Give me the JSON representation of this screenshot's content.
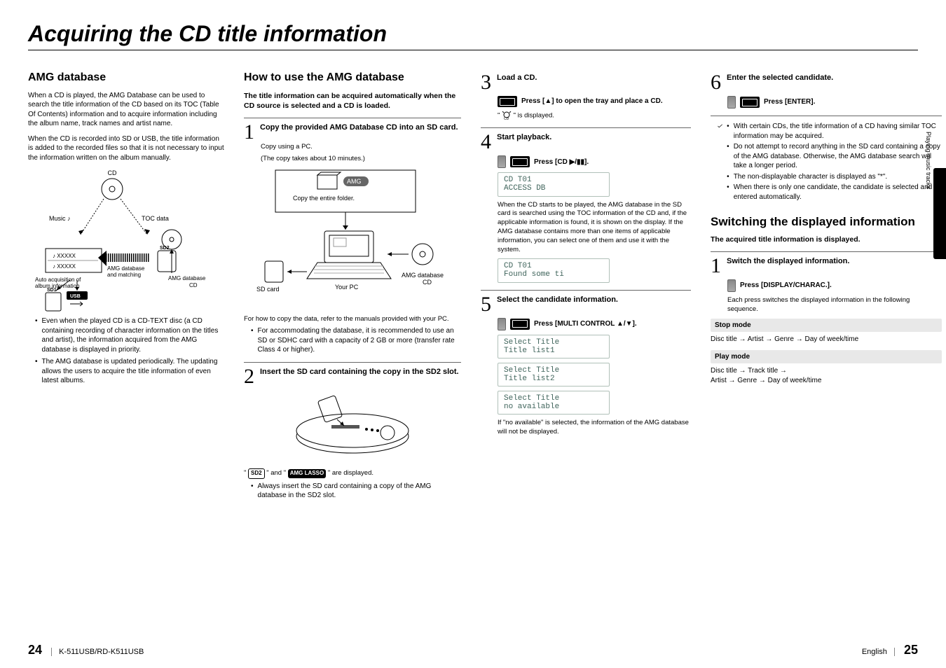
{
  "pageTitle": "Acquiring the CD title information",
  "col1": {
    "h2": "AMG database",
    "p1": "When a CD is played, the AMG Database can be used to search the title information of the CD based on its TOC (Table Of Contents) information and to acquire information including the album name, track names and artist name.",
    "p2": "When the CD is recorded into SD or USB, the title information is added to the recorded files so that it is not necessary to input the information written on the album manually.",
    "diagLabels": {
      "cd": "CD",
      "music": "Music",
      "toc": "TOC data",
      "xxxx": "XXXXX",
      "sd2": "SD2",
      "amgMatch": "AMG database\nand matching",
      "autoAcq": "Auto acquisition of\nalbum information",
      "amgCd": "AMG database\nCD",
      "sd1": "SD1",
      "usb": "USB"
    },
    "b1": "Even when the played CD is a CD-TEXT disc (a CD containing recording of character information on the titles and artist), the information acquired from the AMG database is displayed in priority.",
    "b2": "The AMG database is updated periodically. The updating allows the users to acquire the title information of even latest albums."
  },
  "col2": {
    "h2": "How to use the AMG database",
    "lead": "The title information can be acquired automatically when the CD source is selected and a CD is loaded.",
    "s1": "Copy the provided AMG Database CD into an SD card.",
    "s1a": "Copy using a PC.",
    "s1b": "(The copy takes about 10 minutes.)",
    "diag2": {
      "amg": "AMG",
      "copy": "Copy the entire folder.",
      "sd": "SD card",
      "pc": "Your PC",
      "amgcd": "AMG database\nCD"
    },
    "after1": "For how to copy the data, refer to the manuals provided with your PC.",
    "b1": "For accommodating the database, it is recommended to use an SD or SDHC card with a capacity of 2 GB or more (transfer rate Class 4 or higher).",
    "s2": "Insert the SD card containing the copy in the SD2 slot.",
    "disp": "\" SD2 \" and \" AMG LASSO \" are displayed.",
    "b2": "Always insert the SD card containing a copy of the AMG database in the SD2 slot."
  },
  "col3": {
    "s3": "Load a CD.",
    "s3a": "Press [▲] to open the tray and place a CD.",
    "s3b": "\"  \" is displayed.",
    "s3bIconHint": "cd-access",
    "s4": "Start playback.",
    "s4a": "Press [CD ▶/▮▮].",
    "lcd1a": "CD T01",
    "lcd1b": "ACCESS DB",
    "s4p": "When the CD starts to be played, the AMG database in the SD card is searched using the TOC information of the CD and, if the applicable information is found, it is shown on the display. If the AMG database contains more than one items of applicable information, you can select one of them and use it with the system.",
    "lcd2a": "CD T01",
    "lcd2b": "Found some ti",
    "s5": "Select the candidate information.",
    "s5a": "Press [MULTI CONTROL ▲/▼].",
    "lcd3a": "Select Title",
    "lcd3b": "Title list1",
    "lcd4a": "Select Title",
    "lcd4b": "Title list2",
    "lcd5a": "Select Title",
    "lcd5b": "no available",
    "s5p": "If \"no available\" is selected, the information of the AMG database will not be displayed."
  },
  "col4": {
    "s6": "Enter the selected candidate.",
    "s6a": "Press [ENTER].",
    "chk1": "With certain CDs, the title information of a CD having similar TOC information may be acquired.",
    "chk2": "Do not attempt to record anything in the SD card containing a copy of the AMG database. Otherwise, the AMG database search will take a longer period.",
    "chk3": "The non-displayable character is displayed as \"*\".",
    "chk4": "When there is only one candidate, the candidate is selected and entered automatically.",
    "h2": "Switching the displayed information",
    "lead": "The acquired title information is displayed.",
    "s1": "Switch the displayed information.",
    "s1a": "Press [DISPLAY/CHARAC.].",
    "p1": "Each press switches the displayed information in the following sequence.",
    "mode1": "Stop mode",
    "mode1t": "Disc title → Artist → Genre → Day of week/time",
    "mode2": "Play mode",
    "mode2t": "Disc title → Track title →\nArtist → Genre → Day of week/time"
  },
  "footer": {
    "leftNum": "24",
    "leftText": "K-511USB/RD-K511USB",
    "rightText": "English",
    "rightNum": "25"
  },
  "sideTab": "Playing music tracks"
}
